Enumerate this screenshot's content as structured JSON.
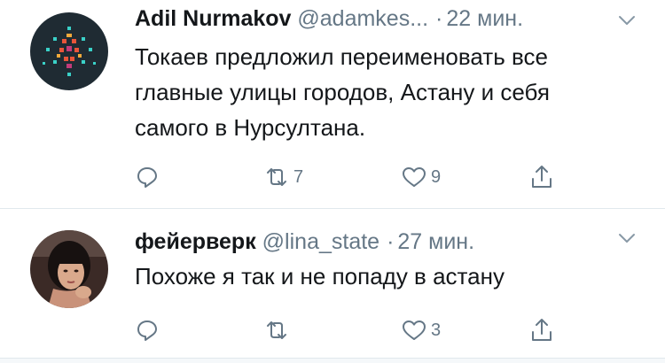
{
  "tweets": [
    {
      "name": "Adil Nurmakov",
      "handle": "@adamkes...",
      "separator": "·",
      "time": "22 мин.",
      "text": "Токаев предложил переименовать все главные улицы городов, Астану и себя самого в Нурсултана.",
      "retweets": "7",
      "likes": "9"
    },
    {
      "name": "фейерверк",
      "handle": "@lina_state",
      "separator": "·",
      "time": "27 мин.",
      "text": "Похоже я так и не попаду в астану",
      "retweets": "",
      "likes": "3"
    }
  ],
  "colors": {
    "text": "#14171a",
    "muted": "#657786",
    "divider": "#e1e8ed"
  },
  "icons": [
    "reply-icon",
    "retweet-icon",
    "like-icon",
    "share-icon",
    "chevron-down-icon"
  ]
}
